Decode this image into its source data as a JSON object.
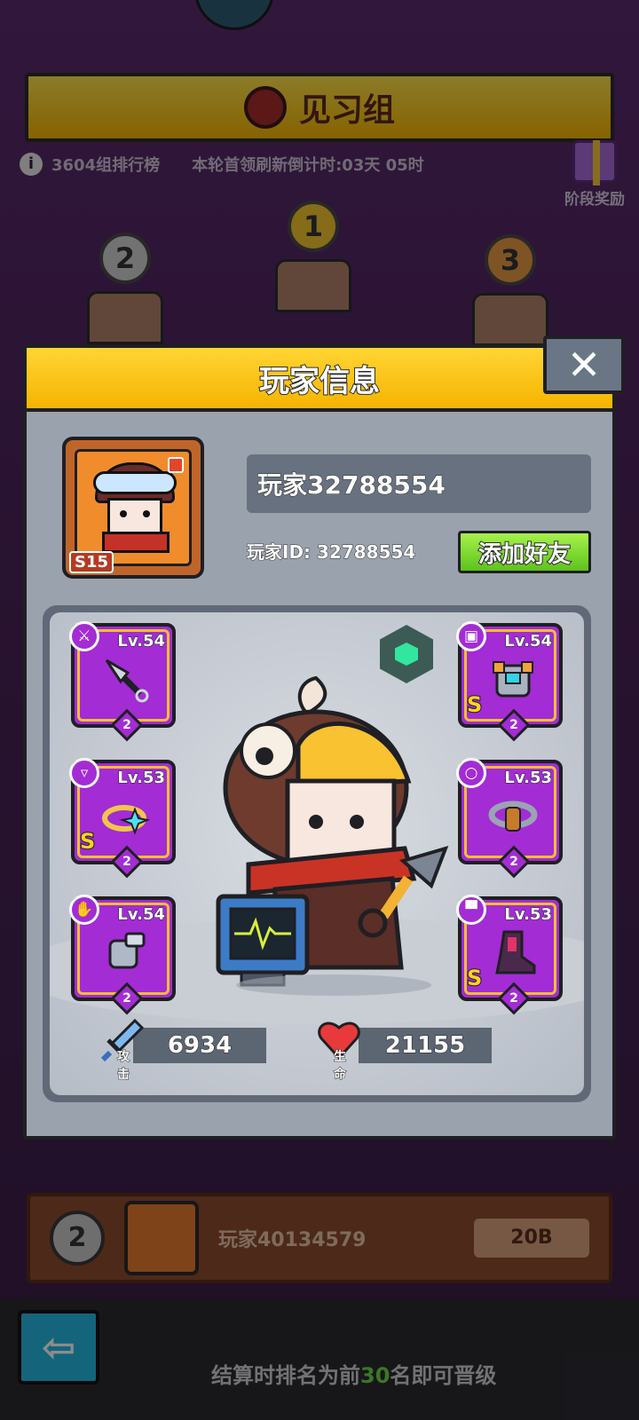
{
  "background": {
    "group_title": "见习组",
    "leaderboard_label": "3604组排行榜",
    "countdown_text": "本轮首领刷新倒计时:03天 05时",
    "stage_reward_label": "阶段奖励",
    "podium": [
      {
        "rank": "2"
      },
      {
        "rank": "1"
      },
      {
        "rank": "3"
      }
    ],
    "my_entry": {
      "rank": "2",
      "name": "玩家40134579",
      "score": "20B"
    },
    "footer": {
      "prefix": "结算时排名为前",
      "count": "30",
      "suffix": "名即可晋级"
    }
  },
  "modal": {
    "title": "玩家信息",
    "close_icon": "close-icon",
    "player_name": "玩家32788554",
    "player_id": "玩家ID: 32788554",
    "tier_badge": "S15",
    "add_friend_label": "添加好友",
    "equipment": [
      {
        "slot": "weapon",
        "icon": "sword-icon",
        "level": "Lv.54",
        "stars": "2",
        "rank": ""
      },
      {
        "slot": "necklace",
        "icon": "necklace-icon",
        "level": "Lv.53",
        "stars": "2",
        "rank": "S"
      },
      {
        "slot": "gloves",
        "icon": "glove-icon",
        "level": "Lv.54",
        "stars": "2",
        "rank": ""
      },
      {
        "slot": "armor",
        "icon": "shirt-icon",
        "level": "Lv.54",
        "stars": "2",
        "rank": "S"
      },
      {
        "slot": "belt",
        "icon": "ring-icon",
        "level": "Lv.53",
        "stars": "2",
        "rank": ""
      },
      {
        "slot": "boots",
        "icon": "boot-icon",
        "level": "Lv.53",
        "stars": "2",
        "rank": "S"
      }
    ],
    "stats": {
      "attack_label": "攻击",
      "attack_value": "6934",
      "hp_label": "生命",
      "hp_value": "21155"
    }
  },
  "colors": {
    "header_yellow": "#f7b400",
    "modal_gray": "#9aa2ae",
    "slot_purple": "#a32cd4",
    "button_green": "#5ec21e",
    "highlight_green": "#6fd84a"
  }
}
